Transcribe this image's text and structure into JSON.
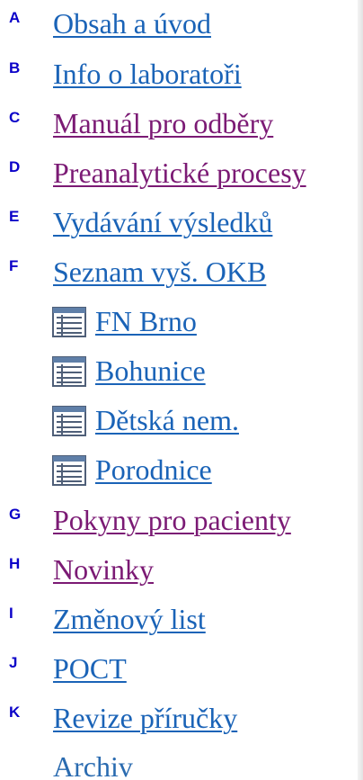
{
  "menu": [
    {
      "marker": "A",
      "label": "Obsah a úvod",
      "color": "blue"
    },
    {
      "marker": "B",
      "label": "Info o laboratoři",
      "color": "blue"
    },
    {
      "marker": "C",
      "label": "Manuál pro odběry",
      "color": "purple"
    },
    {
      "marker": "D",
      "label": "Preanalytické procesy",
      "color": "purple"
    },
    {
      "marker": "E",
      "label": "Vydávání výsledků",
      "color": "blue"
    },
    {
      "marker": "F",
      "label": "Seznam vyš. OKB",
      "color": "blue"
    }
  ],
  "submenu": [
    {
      "label": "FN Brno",
      "icon": "list-document-icon"
    },
    {
      "label": "Bohunice",
      "icon": "list-document-icon"
    },
    {
      "label": "Dětská nem.",
      "icon": "list-document-icon"
    },
    {
      "label": "Porodnice",
      "icon": "list-document-icon"
    }
  ],
  "menu2": [
    {
      "marker": "G",
      "label": "Pokyny pro pacienty",
      "color": "purple"
    },
    {
      "marker": "H",
      "label": "Novinky",
      "color": "purple"
    },
    {
      "marker": "I",
      "label": "Změnový list",
      "color": "blue"
    },
    {
      "marker": "J",
      "label": "POCT",
      "color": "blue"
    },
    {
      "marker": "K",
      "label": "Revize příručky",
      "color": "blue"
    }
  ],
  "archive": {
    "label": "Archiv"
  },
  "colors": {
    "link_blue": "#1a63b7",
    "link_visited_purple": "#7b1a74",
    "marker_blue": "#0a00c8"
  }
}
